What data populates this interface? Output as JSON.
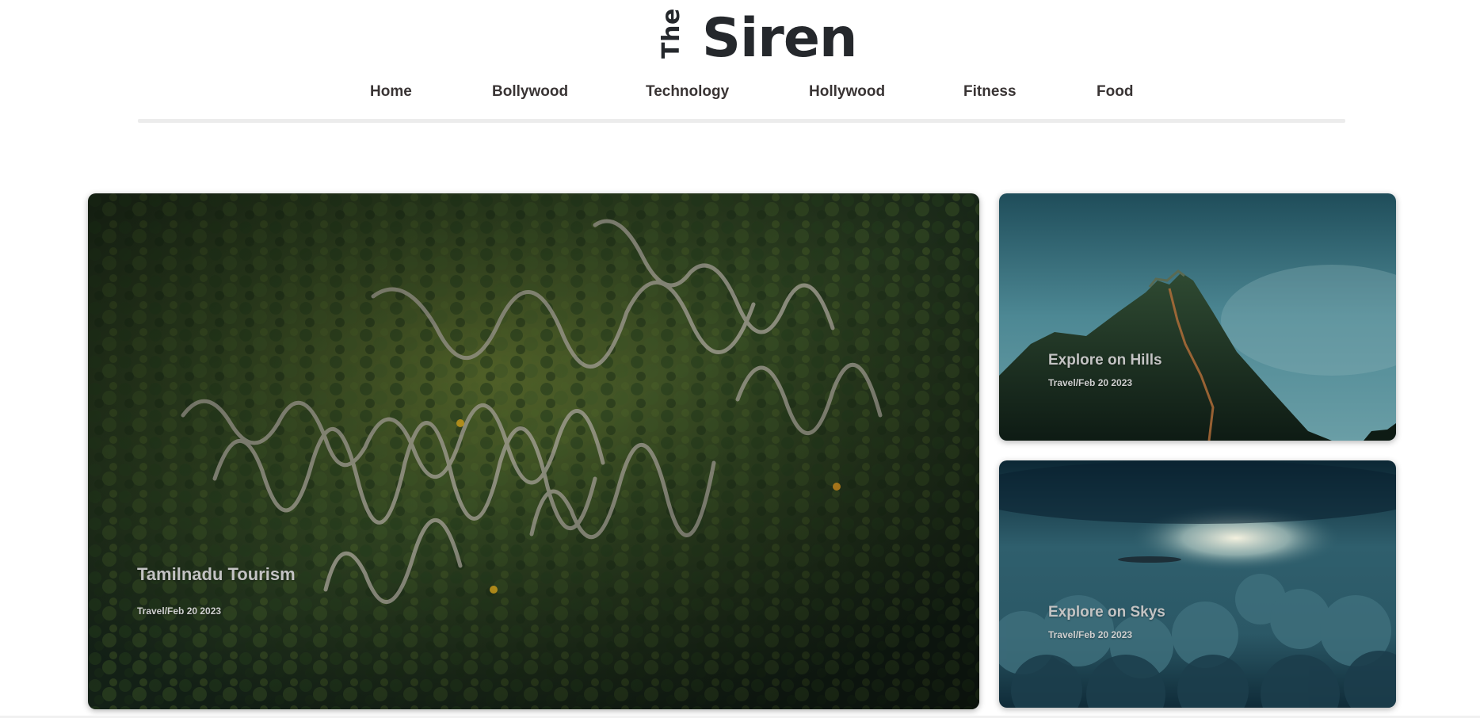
{
  "site": {
    "logo_small": "The",
    "logo_large": "Siren"
  },
  "nav": {
    "items": [
      {
        "label": "Home"
      },
      {
        "label": "Bollywood"
      },
      {
        "label": "Technology"
      },
      {
        "label": "Hollywood"
      },
      {
        "label": "Fitness"
      },
      {
        "label": "Food"
      }
    ]
  },
  "featured": {
    "main": {
      "title": "Tamilnadu Tourism",
      "meta": "Travel/Feb 20 2023",
      "image_icon": "forest-hairpin-road-image"
    },
    "side": [
      {
        "title": "Explore on Hills",
        "meta": "Travel/Feb 20 2023",
        "image_icon": "mountain-fort-image"
      },
      {
        "title": "Explore on Skys",
        "meta": "Travel/Feb 20 2023",
        "image_icon": "cloudy-sky-image"
      }
    ]
  },
  "colors": {
    "text_dark": "#25282c",
    "nav_text": "#393434",
    "divider": "#ececec",
    "overlay_text": "#c3c3c3"
  }
}
